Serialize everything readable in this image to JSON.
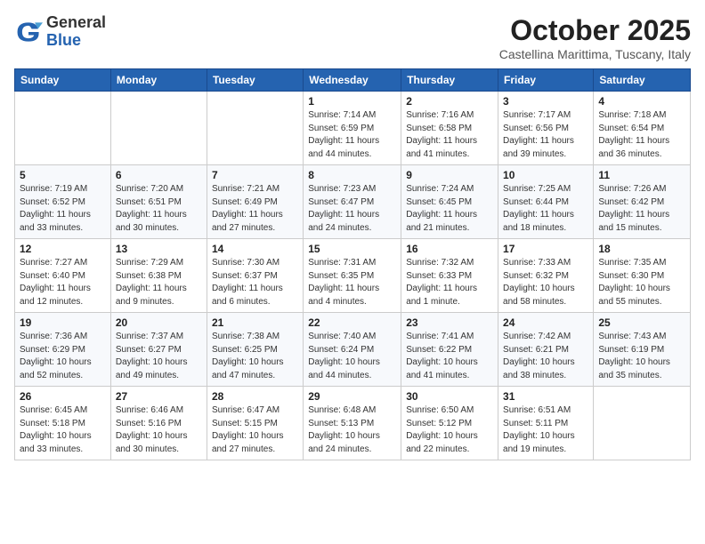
{
  "header": {
    "logo_line1": "General",
    "logo_line2": "Blue",
    "month": "October 2025",
    "location": "Castellina Marittima, Tuscany, Italy"
  },
  "days_of_week": [
    "Sunday",
    "Monday",
    "Tuesday",
    "Wednesday",
    "Thursday",
    "Friday",
    "Saturday"
  ],
  "weeks": [
    [
      {
        "day": "",
        "info": ""
      },
      {
        "day": "",
        "info": ""
      },
      {
        "day": "",
        "info": ""
      },
      {
        "day": "1",
        "info": "Sunrise: 7:14 AM\nSunset: 6:59 PM\nDaylight: 11 hours and 44 minutes."
      },
      {
        "day": "2",
        "info": "Sunrise: 7:16 AM\nSunset: 6:58 PM\nDaylight: 11 hours and 41 minutes."
      },
      {
        "day": "3",
        "info": "Sunrise: 7:17 AM\nSunset: 6:56 PM\nDaylight: 11 hours and 39 minutes."
      },
      {
        "day": "4",
        "info": "Sunrise: 7:18 AM\nSunset: 6:54 PM\nDaylight: 11 hours and 36 minutes."
      }
    ],
    [
      {
        "day": "5",
        "info": "Sunrise: 7:19 AM\nSunset: 6:52 PM\nDaylight: 11 hours and 33 minutes."
      },
      {
        "day": "6",
        "info": "Sunrise: 7:20 AM\nSunset: 6:51 PM\nDaylight: 11 hours and 30 minutes."
      },
      {
        "day": "7",
        "info": "Sunrise: 7:21 AM\nSunset: 6:49 PM\nDaylight: 11 hours and 27 minutes."
      },
      {
        "day": "8",
        "info": "Sunrise: 7:23 AM\nSunset: 6:47 PM\nDaylight: 11 hours and 24 minutes."
      },
      {
        "day": "9",
        "info": "Sunrise: 7:24 AM\nSunset: 6:45 PM\nDaylight: 11 hours and 21 minutes."
      },
      {
        "day": "10",
        "info": "Sunrise: 7:25 AM\nSunset: 6:44 PM\nDaylight: 11 hours and 18 minutes."
      },
      {
        "day": "11",
        "info": "Sunrise: 7:26 AM\nSunset: 6:42 PM\nDaylight: 11 hours and 15 minutes."
      }
    ],
    [
      {
        "day": "12",
        "info": "Sunrise: 7:27 AM\nSunset: 6:40 PM\nDaylight: 11 hours and 12 minutes."
      },
      {
        "day": "13",
        "info": "Sunrise: 7:29 AM\nSunset: 6:38 PM\nDaylight: 11 hours and 9 minutes."
      },
      {
        "day": "14",
        "info": "Sunrise: 7:30 AM\nSunset: 6:37 PM\nDaylight: 11 hours and 6 minutes."
      },
      {
        "day": "15",
        "info": "Sunrise: 7:31 AM\nSunset: 6:35 PM\nDaylight: 11 hours and 4 minutes."
      },
      {
        "day": "16",
        "info": "Sunrise: 7:32 AM\nSunset: 6:33 PM\nDaylight: 11 hours and 1 minute."
      },
      {
        "day": "17",
        "info": "Sunrise: 7:33 AM\nSunset: 6:32 PM\nDaylight: 10 hours and 58 minutes."
      },
      {
        "day": "18",
        "info": "Sunrise: 7:35 AM\nSunset: 6:30 PM\nDaylight: 10 hours and 55 minutes."
      }
    ],
    [
      {
        "day": "19",
        "info": "Sunrise: 7:36 AM\nSunset: 6:29 PM\nDaylight: 10 hours and 52 minutes."
      },
      {
        "day": "20",
        "info": "Sunrise: 7:37 AM\nSunset: 6:27 PM\nDaylight: 10 hours and 49 minutes."
      },
      {
        "day": "21",
        "info": "Sunrise: 7:38 AM\nSunset: 6:25 PM\nDaylight: 10 hours and 47 minutes."
      },
      {
        "day": "22",
        "info": "Sunrise: 7:40 AM\nSunset: 6:24 PM\nDaylight: 10 hours and 44 minutes."
      },
      {
        "day": "23",
        "info": "Sunrise: 7:41 AM\nSunset: 6:22 PM\nDaylight: 10 hours and 41 minutes."
      },
      {
        "day": "24",
        "info": "Sunrise: 7:42 AM\nSunset: 6:21 PM\nDaylight: 10 hours and 38 minutes."
      },
      {
        "day": "25",
        "info": "Sunrise: 7:43 AM\nSunset: 6:19 PM\nDaylight: 10 hours and 35 minutes."
      }
    ],
    [
      {
        "day": "26",
        "info": "Sunrise: 6:45 AM\nSunset: 5:18 PM\nDaylight: 10 hours and 33 minutes."
      },
      {
        "day": "27",
        "info": "Sunrise: 6:46 AM\nSunset: 5:16 PM\nDaylight: 10 hours and 30 minutes."
      },
      {
        "day": "28",
        "info": "Sunrise: 6:47 AM\nSunset: 5:15 PM\nDaylight: 10 hours and 27 minutes."
      },
      {
        "day": "29",
        "info": "Sunrise: 6:48 AM\nSunset: 5:13 PM\nDaylight: 10 hours and 24 minutes."
      },
      {
        "day": "30",
        "info": "Sunrise: 6:50 AM\nSunset: 5:12 PM\nDaylight: 10 hours and 22 minutes."
      },
      {
        "day": "31",
        "info": "Sunrise: 6:51 AM\nSunset: 5:11 PM\nDaylight: 10 hours and 19 minutes."
      },
      {
        "day": "",
        "info": ""
      }
    ]
  ]
}
